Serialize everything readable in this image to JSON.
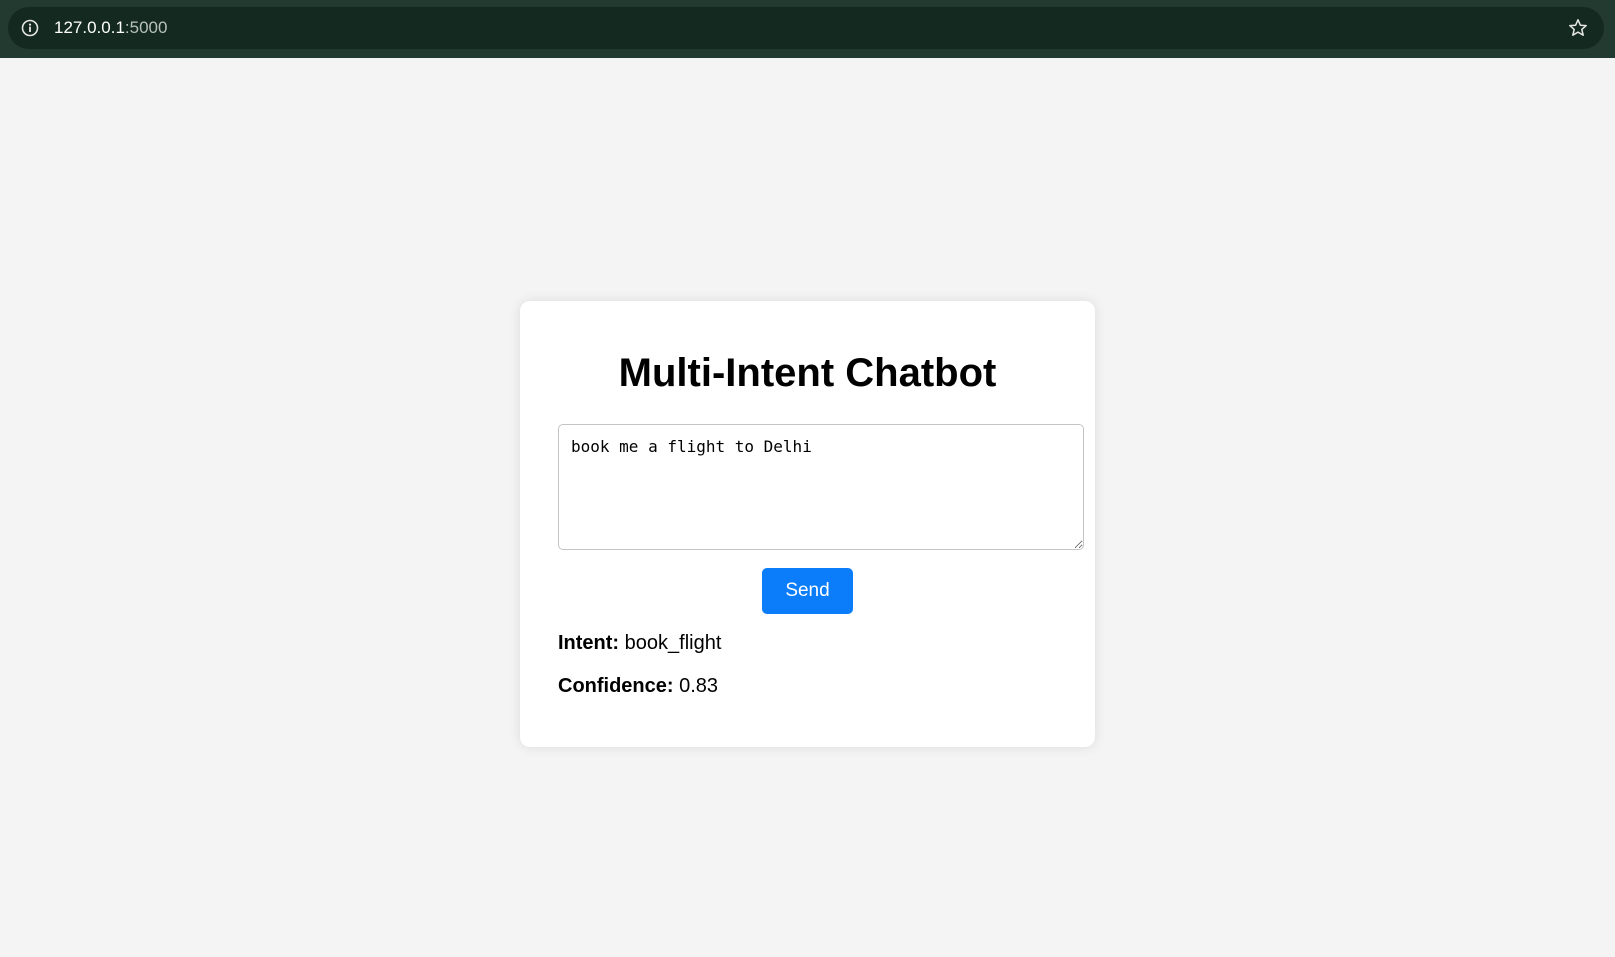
{
  "browser": {
    "url_host": "127.0.0.1",
    "url_port": ":5000"
  },
  "chat": {
    "title": "Multi-Intent Chatbot",
    "input_value": "book me a flight to Delhi",
    "send_label": "Send",
    "intent_label": "Intent:",
    "intent_value": "book_flight",
    "confidence_label": "Confidence:",
    "confidence_value": "0.83"
  },
  "colors": {
    "browser_bar": "#223a30",
    "omnibox": "#142a20",
    "page_bg": "#f4f4f4",
    "button": "#0b7dfb"
  },
  "icons": {
    "site_info": "info-icon",
    "bookmark": "star-icon"
  }
}
